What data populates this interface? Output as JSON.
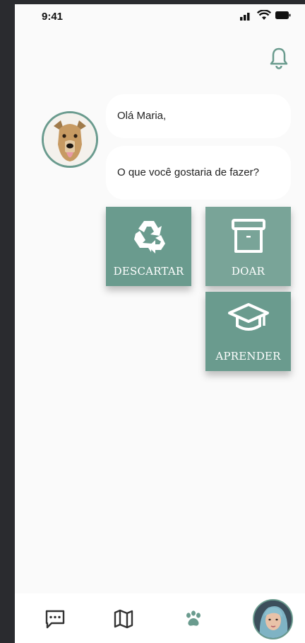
{
  "status_bar": {
    "time": "9:41",
    "icons": [
      "signal-icon",
      "wifi-icon",
      "battery-icon"
    ]
  },
  "header": {
    "icon": "bell-icon"
  },
  "chat": {
    "greeting": "Olá Maria,",
    "question": "O que você gostaria de fazer?"
  },
  "actions": [
    {
      "label": "DESCARTAR",
      "icon": "recycle-icon"
    },
    {
      "label": "DOAR",
      "icon": "archive-box-icon"
    },
    {
      "label": "APRENDER",
      "icon": "graduation-cap-icon"
    }
  ],
  "bottom_nav": {
    "items": [
      "chat-icon",
      "map-icon",
      "paw-icon",
      "profile-avatar"
    ]
  },
  "colors": {
    "accent": "#6a9b8e",
    "accent_light": "#79a498",
    "background": "#fafafa"
  }
}
